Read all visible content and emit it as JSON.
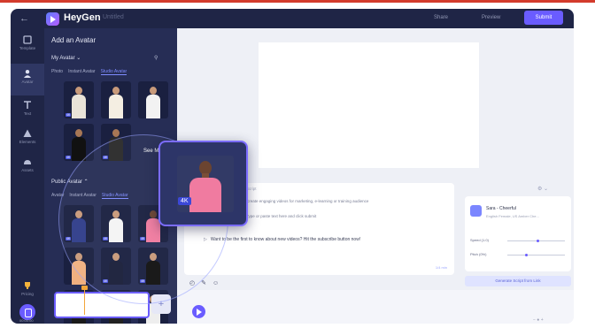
{
  "app": {
    "brand": "HeyGen",
    "draft_label": "Untitled"
  },
  "topbar": {
    "preview_label": "Preview",
    "submit_label": "Submit",
    "extra_label": "Share"
  },
  "rail": [
    {
      "label": "Template",
      "icon": "template-icon"
    },
    {
      "label": "Avatar",
      "icon": "avatar-icon"
    },
    {
      "label": "Text",
      "icon": "text-icon"
    },
    {
      "label": "Elements",
      "icon": "elements-icon"
    },
    {
      "label": "Assets",
      "icon": "assets-icon"
    },
    {
      "label": "Pricing",
      "icon": "pricing-icon"
    }
  ],
  "panel": {
    "title": "Add an Avatar",
    "my_avatar": "My Avatar",
    "my_tabs": [
      "Photo",
      "Instant Avatar",
      "Studio Avatar"
    ],
    "see_more": "See More",
    "public_avatar": "Public Avatar",
    "public_tabs": [
      "Avatar",
      "Instant Avatar",
      "Studio Avatar"
    ]
  },
  "zoom": {
    "badge": "4K"
  },
  "script": {
    "header": "Script",
    "lines": [
      "Create engaging videos for marketing, e-learning or training audience",
      "Type or paste text here and click submit"
    ],
    "current_line": "Want to be the first to know about new videos? Hit the subscribe button now!",
    "footer": "1/4 min"
  },
  "voice": {
    "name": "Sara - Cheerful",
    "sub": "English Female, US Amber Che...",
    "speed_label": "Speed (1.0)",
    "pitch_label": "Pitch (0%)",
    "speed_value": 0.5,
    "pitch_value": 0.3
  },
  "generate_label": "Generate Script from Link",
  "timeline": {
    "time": "00:00:00",
    "add": "+"
  }
}
